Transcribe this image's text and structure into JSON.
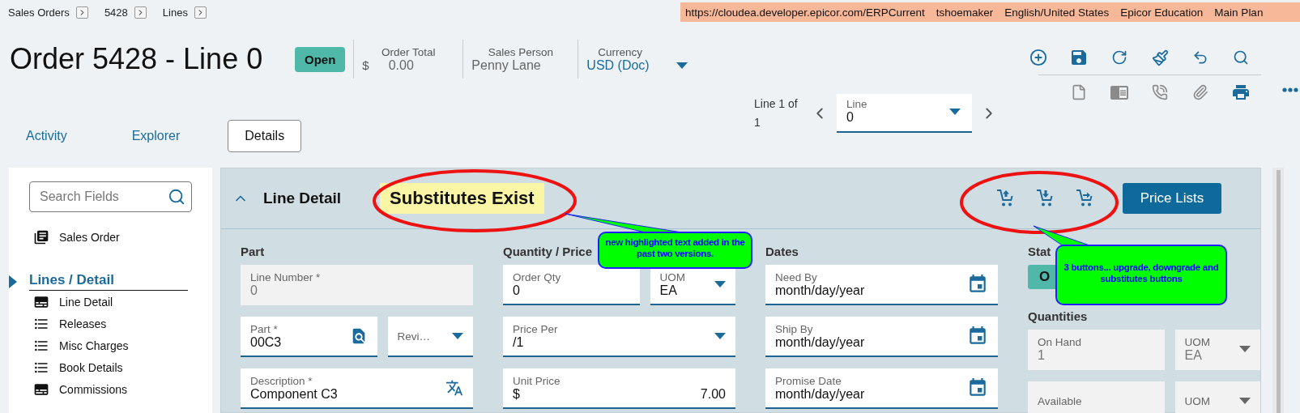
{
  "breadcrumbs": [
    {
      "label": "Sales Orders"
    },
    {
      "label": "5428"
    },
    {
      "label": "Lines"
    }
  ],
  "environment_bar": [
    "https://cloudea.developer.epicor.com/ERPCurrent",
    "tshoemaker",
    "English/United States",
    "Epicor Education",
    "Main Plan"
  ],
  "header": {
    "title": "Order 5428 - Line 0",
    "status": "Open",
    "order_total": {
      "label": "Order Total",
      "currency": "$",
      "value": "0.00"
    },
    "sales_person": {
      "label": "Sales Person",
      "value": "Penny Lane"
    },
    "currency": {
      "label": "Currency",
      "value": "USD (Doc)"
    }
  },
  "toolbar": {
    "primary": [
      {
        "kind": "add",
        "disabled": false
      },
      {
        "kind": "save",
        "disabled": false
      },
      {
        "kind": "refresh",
        "disabled": false
      },
      {
        "kind": "clear",
        "disabled": false
      },
      {
        "kind": "undo",
        "disabled": false
      },
      {
        "kind": "search",
        "disabled": false
      }
    ],
    "secondary": [
      {
        "kind": "page",
        "disabled": true
      },
      {
        "kind": "card",
        "disabled": true
      },
      {
        "kind": "phone",
        "disabled": true
      },
      {
        "kind": "attachment",
        "disabled": true
      },
      {
        "kind": "print",
        "disabled": false
      }
    ]
  },
  "tabs": [
    {
      "label": "Activity",
      "selected": false
    },
    {
      "label": "Explorer",
      "selected": false
    },
    {
      "label": "Details",
      "selected": true
    }
  ],
  "line_nav": {
    "position": "Line 1 of 1",
    "label": "Line",
    "value": "0"
  },
  "sidebar": {
    "search": {
      "placeholder": "Search Fields"
    },
    "top_item": {
      "label": "Sales Order",
      "kind": "cards"
    },
    "section": {
      "label": "Lines / Detail",
      "active": true
    },
    "items": [
      {
        "label": "Line Detail",
        "kind": "form"
      },
      {
        "label": "Releases",
        "kind": "list"
      },
      {
        "label": "Misc Charges",
        "kind": "list"
      },
      {
        "label": "Book Details",
        "kind": "list"
      },
      {
        "label": "Commissions",
        "kind": "form"
      }
    ]
  },
  "panel": {
    "title": "Line Detail",
    "expanded": true,
    "notice": "Substitutes Exist",
    "actions": [
      {
        "kind": "upgrade"
      },
      {
        "kind": "downgrade"
      },
      {
        "kind": "substitutes"
      }
    ],
    "button": "Price Lists",
    "columns": [
      {
        "items": [
          {
            "kind": "heading",
            "text": "Part"
          },
          {
            "kind": "fields",
            "fields": [
              {
                "label": "Line Number *",
                "value": "0",
                "kind": "text",
                "disabled": true
              }
            ]
          },
          {
            "kind": "fields",
            "fields": [
              {
                "label": "Part *",
                "value": "00C3",
                "kind": "lookup",
                "disabled": false
              },
              {
                "label": "Revi…",
                "kind": "select",
                "disabled": false
              }
            ]
          },
          {
            "kind": "fields",
            "fields": [
              {
                "label": "Description *",
                "value": "Component C3",
                "kind": "translate",
                "disabled": false
              }
            ]
          }
        ]
      },
      {
        "items": [
          {
            "kind": "heading",
            "text": "Quantity / Price"
          },
          {
            "kind": "fields",
            "fields": [
              {
                "label": "Order Qty",
                "value": "0",
                "kind": "text",
                "disabled": false
              },
              {
                "label": "UOM",
                "value": "EA",
                "kind": "select",
                "disabled": false
              }
            ]
          },
          {
            "kind": "fields",
            "fields": [
              {
                "label": "Price Per",
                "value": "/1",
                "kind": "select",
                "disabled": false
              }
            ]
          },
          {
            "kind": "fields",
            "fields": [
              {
                "label": "Unit Price",
                "currency": "$",
                "value": "7.00",
                "kind": "currency",
                "disabled": false
              }
            ]
          }
        ]
      },
      {
        "items": [
          {
            "kind": "heading",
            "text": "Dates"
          },
          {
            "kind": "fields",
            "fields": [
              {
                "label": "Need By",
                "value": "month/day/year",
                "kind": "date",
                "disabled": false
              }
            ]
          },
          {
            "kind": "fields",
            "fields": [
              {
                "label": "Ship By",
                "value": "month/day/year",
                "kind": "date",
                "disabled": false
              }
            ]
          },
          {
            "kind": "fields",
            "fields": [
              {
                "label": "Promise Date",
                "value": "month/day/year",
                "kind": "date",
                "disabled": false
              }
            ]
          }
        ]
      },
      {
        "items": [
          {
            "kind": "heading",
            "text": "Stat"
          },
          {
            "kind": "status",
            "text": "O"
          },
          {
            "kind": "heading",
            "text": "Quantities"
          },
          {
            "kind": "fields",
            "fields": [
              {
                "label": "On Hand",
                "value": "1",
                "kind": "text",
                "disabled": true
              },
              {
                "label": "UOM",
                "value": "EA",
                "kind": "select",
                "disabled": true
              }
            ]
          },
          {
            "kind": "fields",
            "fields": [
              {
                "label": "Available",
                "kind": "text",
                "disabled": true
              },
              {
                "label": "UOM",
                "kind": "select",
                "disabled": true
              }
            ]
          }
        ]
      }
    ]
  },
  "annotations": [
    {
      "text": "new highlighted text added in the past two versions."
    },
    {
      "text": "3 buttons... upgrade, downgrade and substitutes buttons"
    }
  ]
}
